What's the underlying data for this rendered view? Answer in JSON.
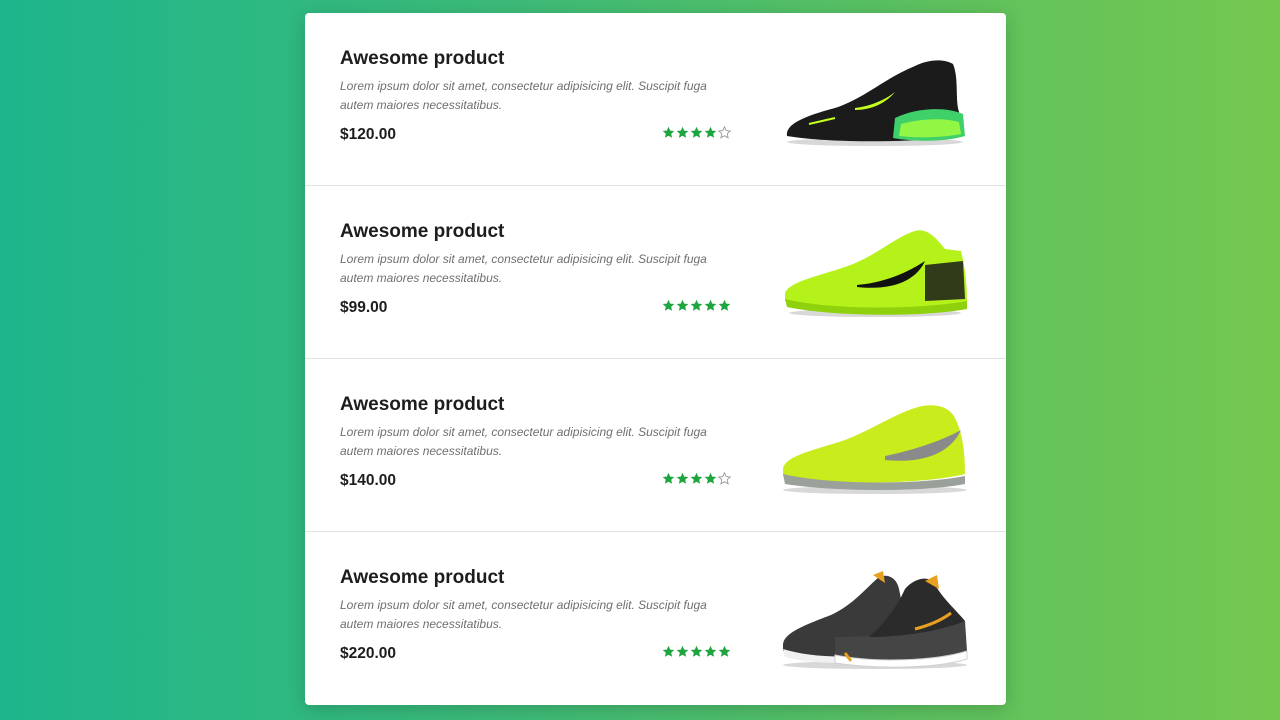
{
  "accent_color": "#1fa53f",
  "products": [
    {
      "title": "Awesome product",
      "description": "Lorem ipsum dolor sit amet, consectetur adipisicing elit. Suscipit fuga autem maiores necessitatibus.",
      "price": "$120.00",
      "rating": 4,
      "image": "black-sneaker-with-green-air-sole"
    },
    {
      "title": "Awesome product",
      "description": "Lorem ipsum dolor sit amet, consectetur adipisicing elit. Suscipit fuga autem maiores necessitatibus.",
      "price": "$99.00",
      "rating": 5,
      "image": "neon-yellow-running-shoe"
    },
    {
      "title": "Awesome product",
      "description": "Lorem ipsum dolor sit amet, consectetur adipisicing elit. Suscipit fuga autem maiores necessitatibus.",
      "price": "$140.00",
      "rating": 4,
      "image": "volt-tennis-shoe"
    },
    {
      "title": "Awesome product",
      "description": "Lorem ipsum dolor sit amet, consectetur adipisicing elit. Suscipit fuga autem maiores necessitatibus.",
      "price": "$220.00",
      "rating": 5,
      "image": "pair-black-orange-sneakers"
    }
  ]
}
